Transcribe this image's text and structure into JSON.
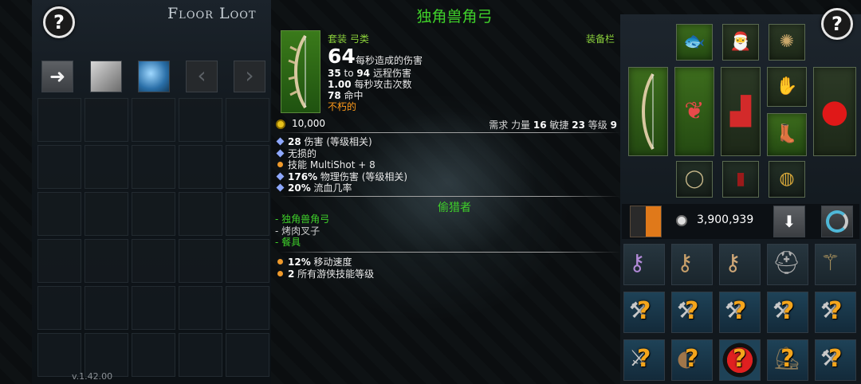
{
  "floor_loot": {
    "title": "Floor Loot",
    "help_label": "?",
    "take_all_icon": "arrow-right-icon",
    "prev_label": "‹",
    "next_label": "›",
    "version": "v.1.42.00"
  },
  "item": {
    "name": "独角兽角弓",
    "category": "套装 弓类",
    "equip_label": "装备栏",
    "dps": "64",
    "dps_label": "每秒造成的伤害",
    "ranged_min": "35",
    "ranged_to": "to",
    "ranged_max": "94",
    "ranged_label": "远程伤害",
    "attacks_per_sec": "1.00",
    "attacks_label": "每秒攻击次数",
    "hit": "78",
    "hit_label": "命中",
    "indestructible": "不朽的",
    "price": "10,000",
    "req_label": "需求 力量",
    "req_strength": "16",
    "req_dex_label": "敏捷",
    "req_dex": "23",
    "req_level_label": "等级",
    "req_level": "9",
    "affixes": [
      {
        "value": "28",
        "text": " 伤害 (等级相关)",
        "bullet": "blue"
      },
      {
        "value": "",
        "text": "无损的",
        "bullet": "blue"
      },
      {
        "value": "",
        "text": "技能 MultiShot + 8",
        "bullet": "orange"
      },
      {
        "value": "176%",
        "text": " 物理伤害 (等级相关)",
        "bullet": "blue"
      },
      {
        "value": "20%",
        "text": " 流血几率",
        "bullet": "blue"
      }
    ],
    "set_name": "偷猎者",
    "set_pieces": [
      {
        "text": "- 独角兽角弓",
        "color": "#3fd12a"
      },
      {
        "text": "- 烤肉叉子",
        "color": "#cfcfcf"
      },
      {
        "text": "- 餐具",
        "color": "#3fd12a"
      }
    ],
    "set_bonuses": [
      {
        "value": "12%",
        "text": " 移动速度"
      },
      {
        "value": "2",
        "text": " 所有游侠技能等级"
      }
    ]
  },
  "equipment": {
    "help_label": "?",
    "gold_total": "3,900,939",
    "sort_icon": "down-arrow-icon"
  },
  "colors": {
    "set_green": "#3fd12a",
    "unique_orange": "#ff9a1a",
    "affix_blue": "#8ea8ff"
  }
}
